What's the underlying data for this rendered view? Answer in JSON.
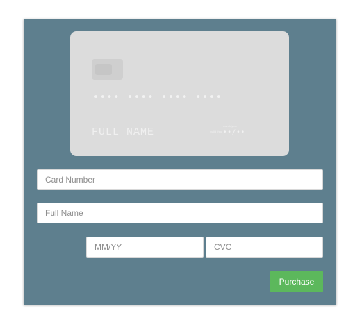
{
  "card_preview": {
    "number_mask": "•••• •••• •••• ••••",
    "name": "FULL NAME",
    "valid_thru": "valid thru",
    "expiry_label": "month/year",
    "expiry_mask": "••/••"
  },
  "form": {
    "card_number": {
      "value": "",
      "placeholder": "Card Number"
    },
    "full_name": {
      "value": "",
      "placeholder": "Full Name"
    },
    "expiry": {
      "value": "",
      "placeholder": "MM/YY"
    },
    "cvc": {
      "value": "",
      "placeholder": "CVC"
    },
    "purchase_label": "Purchase"
  },
  "colors": {
    "panel_background": "#5e7f8e",
    "card_background": "#dcdcdc",
    "purchase_button": "#5cb85c"
  },
  "icons": [
    "card-chip-icon"
  ]
}
